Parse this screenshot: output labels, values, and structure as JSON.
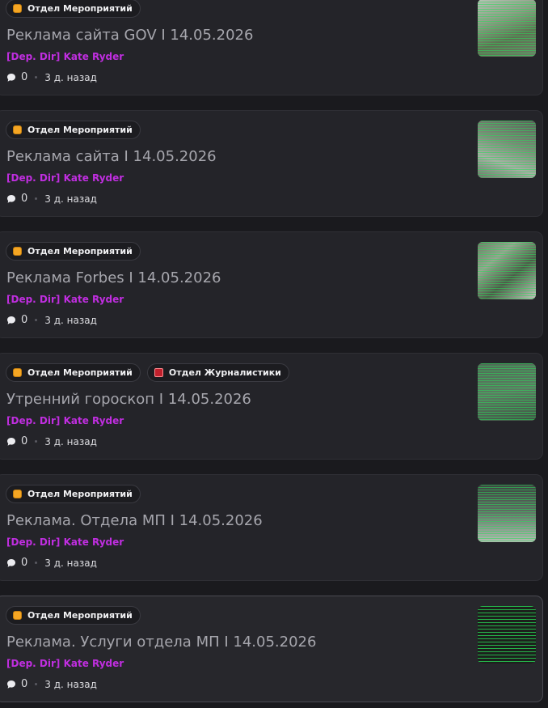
{
  "colors": {
    "background": "#1a1a1e",
    "card": "#242429",
    "author": "#c02ee0",
    "title": "#a6a6ad",
    "tag_events": "#f5a623",
    "tag_journalism": "#c0202c",
    "thumbnail_lines": "#28dc5a"
  },
  "icons": {
    "comments": "speech-bubble-icon",
    "tag_events": "orange-square-icon",
    "tag_journalism": "red-book-icon"
  },
  "posts": [
    {
      "tags": [
        "Отдел Мероприятий"
      ],
      "title": "Реклама сайта GOV I 14.05.2026",
      "author": "[Dep. Dir] Kate Ryder",
      "comments": "0",
      "time": "3 д. назад"
    },
    {
      "tags": [
        "Отдел Мероприятий"
      ],
      "title": "Реклама сайта I 14.05.2026",
      "author": "[Dep. Dir] Kate Ryder",
      "comments": "0",
      "time": "3 д. назад"
    },
    {
      "tags": [
        "Отдел Мероприятий"
      ],
      "title": "Реклама Forbes I 14.05.2026",
      "author": "[Dep. Dir] Kate Ryder",
      "comments": "0",
      "time": "3 д. назад"
    },
    {
      "tags": [
        "Отдел Мероприятий",
        "Отдел Журналистики"
      ],
      "title": "Утренний гороскоп I 14.05.2026",
      "author": "[Dep. Dir] Kate Ryder",
      "comments": "0",
      "time": "3 д. назад"
    },
    {
      "tags": [
        "Отдел Мероприятий"
      ],
      "title": "Реклама. Отдела МП I 14.05.2026",
      "author": "[Dep. Dir] Kate Ryder",
      "comments": "0",
      "time": "3 д. назад"
    },
    {
      "tags": [
        "Отдел Мероприятий"
      ],
      "title": "Реклама. Услуги отдела МП I 14.05.2026",
      "author": "[Dep. Dir] Kate Ryder",
      "comments": "0",
      "time": "3 д. назад"
    }
  ]
}
